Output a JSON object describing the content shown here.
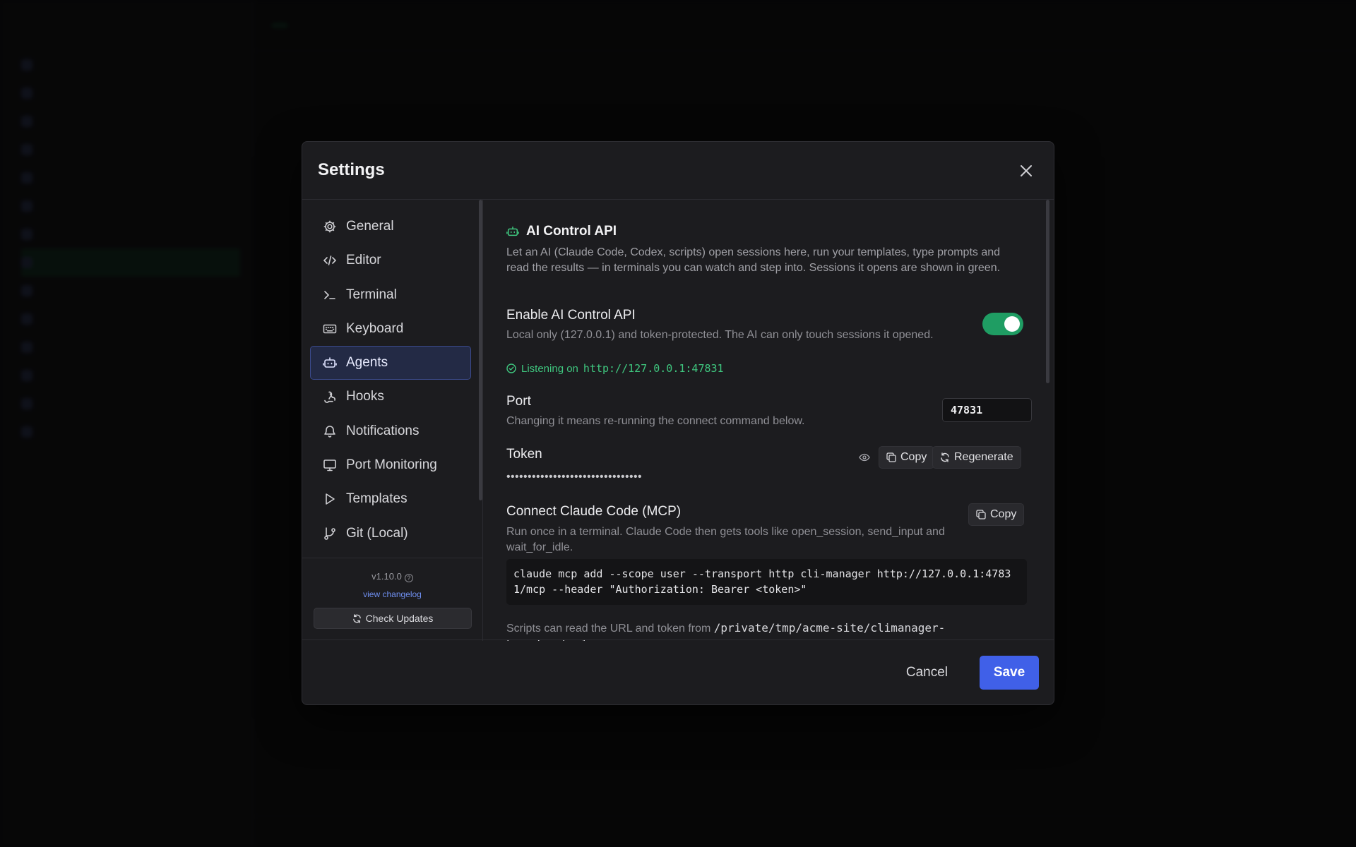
{
  "modal": {
    "title": "Settings"
  },
  "nav": {
    "items": [
      {
        "label": "General",
        "icon": "gear-icon"
      },
      {
        "label": "Editor",
        "icon": "code-icon"
      },
      {
        "label": "Terminal",
        "icon": "terminal-icon"
      },
      {
        "label": "Keyboard",
        "icon": "keyboard-icon"
      },
      {
        "label": "Agents",
        "icon": "robot-icon",
        "active": true
      },
      {
        "label": "Hooks",
        "icon": "webhook-icon"
      },
      {
        "label": "Notifications",
        "icon": "bell-icon"
      },
      {
        "label": "Port Monitoring",
        "icon": "monitor-icon"
      },
      {
        "label": "Templates",
        "icon": "play-icon"
      },
      {
        "label": "Git (Local)",
        "icon": "git-branch-icon"
      }
    ],
    "version": "v1.10.0",
    "changelog_link": "view changelog",
    "check_updates": "Check Updates"
  },
  "agents": {
    "section_title": "AI Control API",
    "section_desc": "Let an AI (Claude Code, Codex, scripts) open sessions here, run your templates, type prompts and read the results — in terminals you can watch and step into. Sessions it opens are shown in green.",
    "enable_title": "Enable AI Control API",
    "enable_desc": "Local only (127.0.0.1) and token-protected. The AI can only touch sessions it opened.",
    "enabled": true,
    "listening_label": "Listening on",
    "listening_url": "http://127.0.0.1:47831",
    "port_title": "Port",
    "port_desc": "Changing it means re-running the connect command below.",
    "port_value": "47831",
    "token_title": "Token",
    "token_masked": "••••••••••••••••••••••••••••••••",
    "copy_label": "Copy",
    "regenerate_label": "Regenerate",
    "mcp_title": "Connect Claude Code (MCP)",
    "mcp_copy_label": "Copy",
    "mcp_desc": "Run once in a terminal. Claude Code then gets tools like open_session, send_input and wait_for_idle.",
    "mcp_command": "claude mcp add --scope user --transport http cli-manager http://127.0.0.1:47831/mcp --header \"Authorization: Bearer <token>\"",
    "scripts_note_prefix": "Scripts can read the URL and token from",
    "scripts_note_path": "/private/tmp/acme-site/climanager-home/control-"
  },
  "footer": {
    "cancel": "Cancel",
    "save": "Save"
  },
  "colors": {
    "accent": "#4060e8",
    "toggle_on": "#1f9d63",
    "listening": "#3fc77f"
  }
}
